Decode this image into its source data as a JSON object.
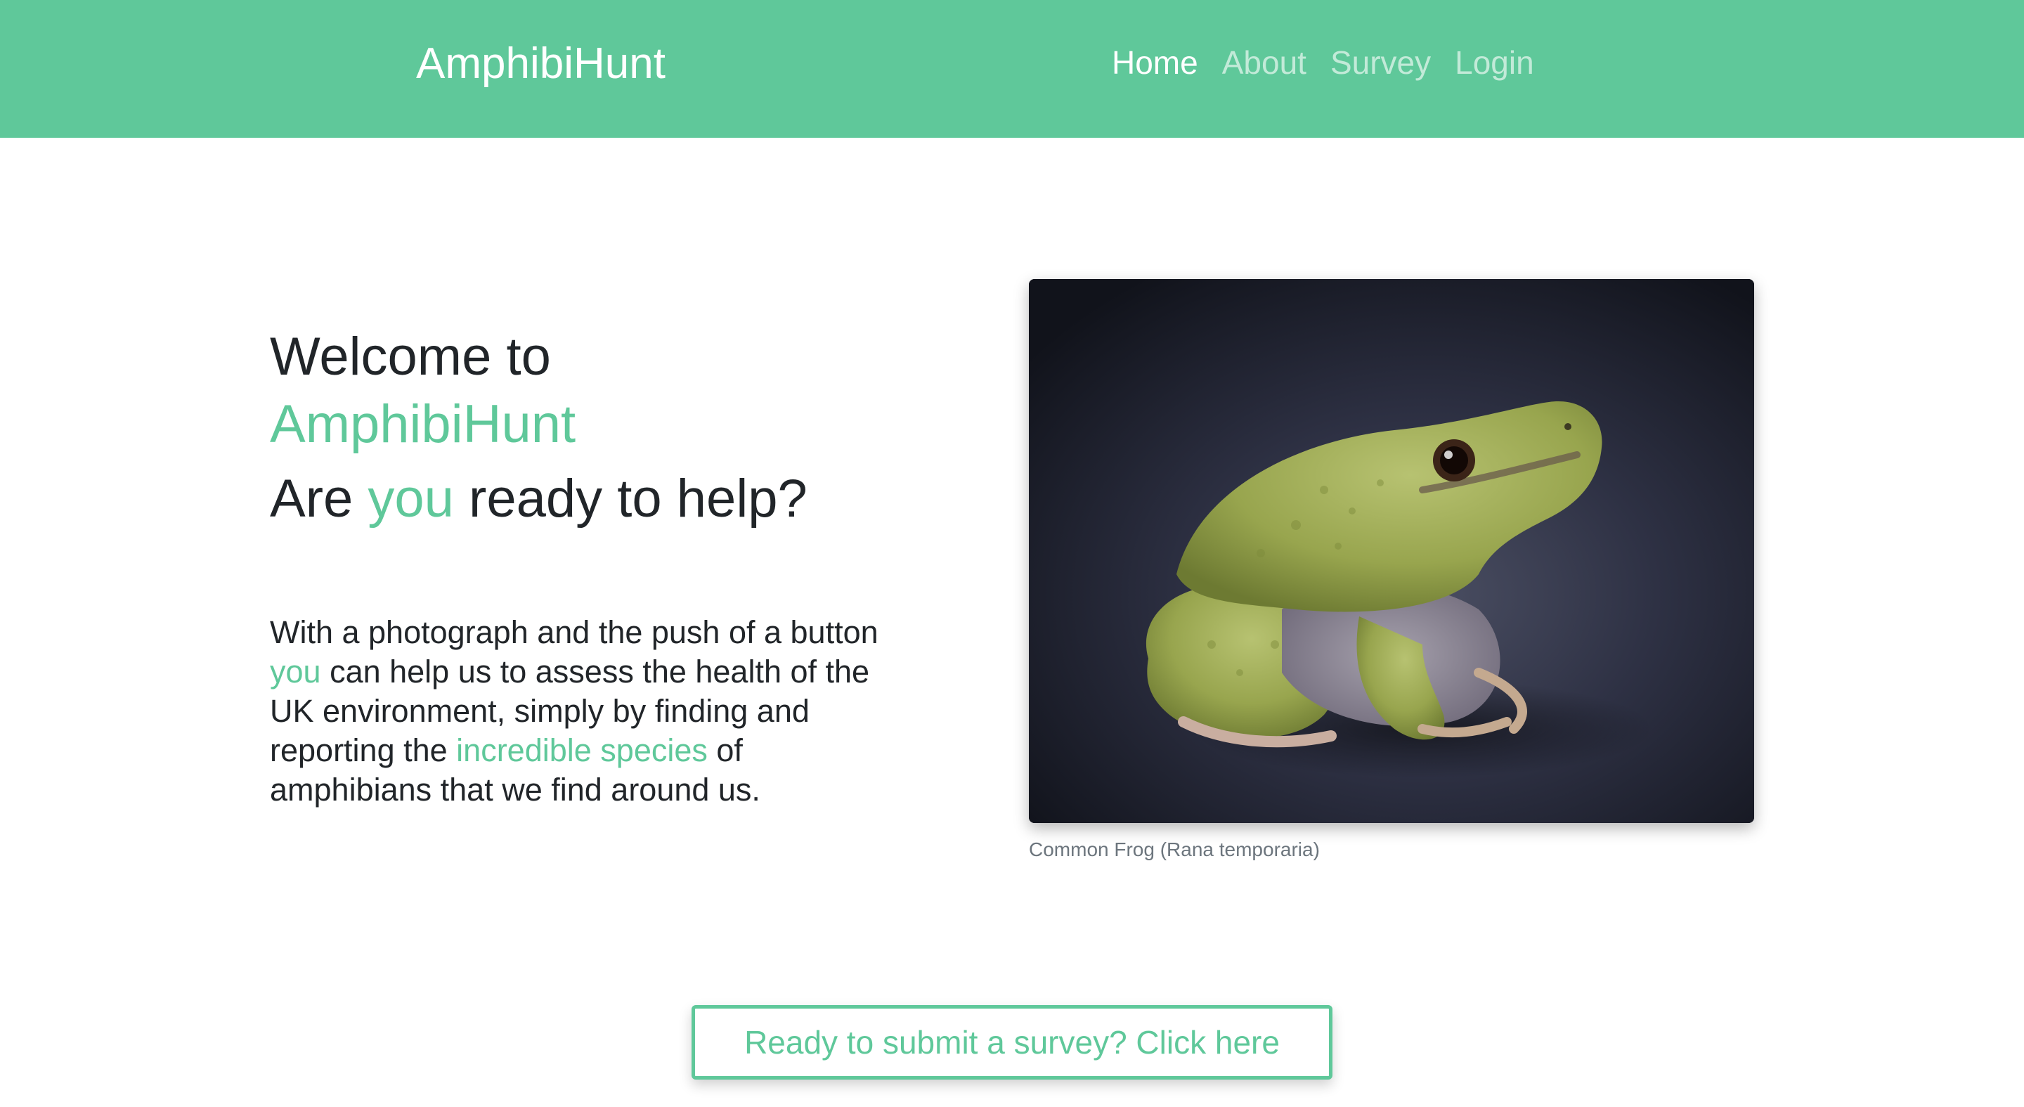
{
  "navbar": {
    "brand": "AmphibiHunt",
    "links": [
      {
        "label": "Home",
        "active": true
      },
      {
        "label": "About",
        "active": false
      },
      {
        "label": "Survey",
        "active": false
      },
      {
        "label": "Login",
        "active": false
      }
    ]
  },
  "hero": {
    "welcome": "Welcome to",
    "brand": "AmphibiHunt",
    "question_part1": "Are ",
    "question_accent": "you",
    "question_part2": " ready to help?",
    "intro_part1": "With a photograph and the push of a button ",
    "intro_accent1": "you",
    "intro_part2": " can help us to assess the health of the UK environment, simply by finding and reporting the ",
    "intro_accent2": "incredible species",
    "intro_part3": " of amphibians that we find around us."
  },
  "figure": {
    "caption": "Common Frog (Rana temporaria)"
  },
  "cta": {
    "label": "Ready to submit a survey? Click here"
  },
  "colors": {
    "accent": "#5fc89a",
    "text": "#212529",
    "caption": "#6c757d"
  }
}
